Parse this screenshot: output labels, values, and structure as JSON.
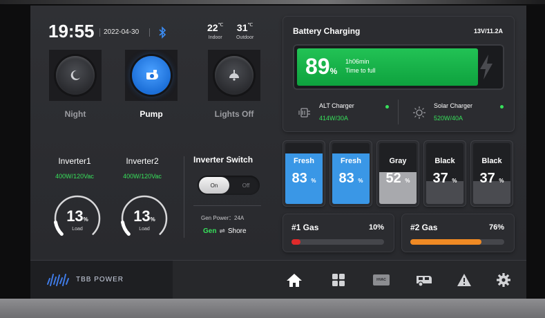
{
  "header": {
    "time": "19:55",
    "date": "2022-04-30",
    "indoor": {
      "value": "22",
      "unit": "℃",
      "label": "Indoor"
    },
    "outdoor": {
      "value": "31",
      "unit": "℃",
      "label": "Outdoor"
    }
  },
  "modes": [
    {
      "label": "Night",
      "icon": "moon-icon",
      "active": false
    },
    {
      "label": "Pump",
      "icon": "pump-icon",
      "active": true
    },
    {
      "label": "Lights Off",
      "icon": "ceiling-lamp-icon",
      "active": false
    }
  ],
  "inverters": [
    {
      "name": "Inverter1",
      "power": "400W/120Vac",
      "load": "13",
      "load_unit": "%",
      "load_label": "Load",
      "load_fraction": 0.13
    },
    {
      "name": "Inverter2",
      "power": "400W/120Vac",
      "load": "13",
      "load_unit": "%",
      "load_label": "Load",
      "load_fraction": 0.13
    }
  ],
  "inverter_switch": {
    "title": "Inverter Switch",
    "on_label": "On",
    "off_label": "Off",
    "state": "On",
    "gen_power": "Gen Power：24A",
    "gen_label": "Gen",
    "swap_icon": "⇌",
    "shore_label": "Shore"
  },
  "battery": {
    "title": "Battery Charging",
    "voltage": "13V/11.2A",
    "percent": "89",
    "percent_unit": "%",
    "level": 0.89,
    "time_value": "1h06min",
    "time_label": "Time to full",
    "chargers": [
      {
        "name": "ALT Charger",
        "power": "414W/30A",
        "icon": "alternator-icon",
        "status_color": "#37e15b"
      },
      {
        "name": "Solar Charger",
        "power": "520W/40A",
        "icon": "sun-icon",
        "status_color": "#37e15b"
      }
    ]
  },
  "tanks": [
    {
      "name": "Fresh",
      "value": "83",
      "unit": "%",
      "level": 0.83,
      "color": "#3a97e6"
    },
    {
      "name": "Fresh",
      "value": "83",
      "unit": "%",
      "level": 0.83,
      "color": "#3a97e6"
    },
    {
      "name": "Gray",
      "value": "52",
      "unit": "%",
      "level": 0.52,
      "color": "#a8a9ad"
    },
    {
      "name": "Black",
      "value": "37",
      "unit": "%",
      "level": 0.37,
      "color": "#4a4b50"
    },
    {
      "name": "Black",
      "value": "37",
      "unit": "%",
      "level": 0.37,
      "color": "#4a4b50"
    }
  ],
  "gas": [
    {
      "name": "#1 Gas",
      "value": "10%",
      "level": 0.1,
      "color": "#e02a2a"
    },
    {
      "name": "#2 Gas",
      "value": "76%",
      "level": 0.76,
      "color": "#f08a24"
    }
  ],
  "footer": {
    "brand": "TBB POWER",
    "nav": [
      "home-icon",
      "dashboard-grid-icon",
      "hvac-icon",
      "camper-icon",
      "warning-icon",
      "settings-gear-icon"
    ],
    "hvac_text": "HVAC"
  }
}
